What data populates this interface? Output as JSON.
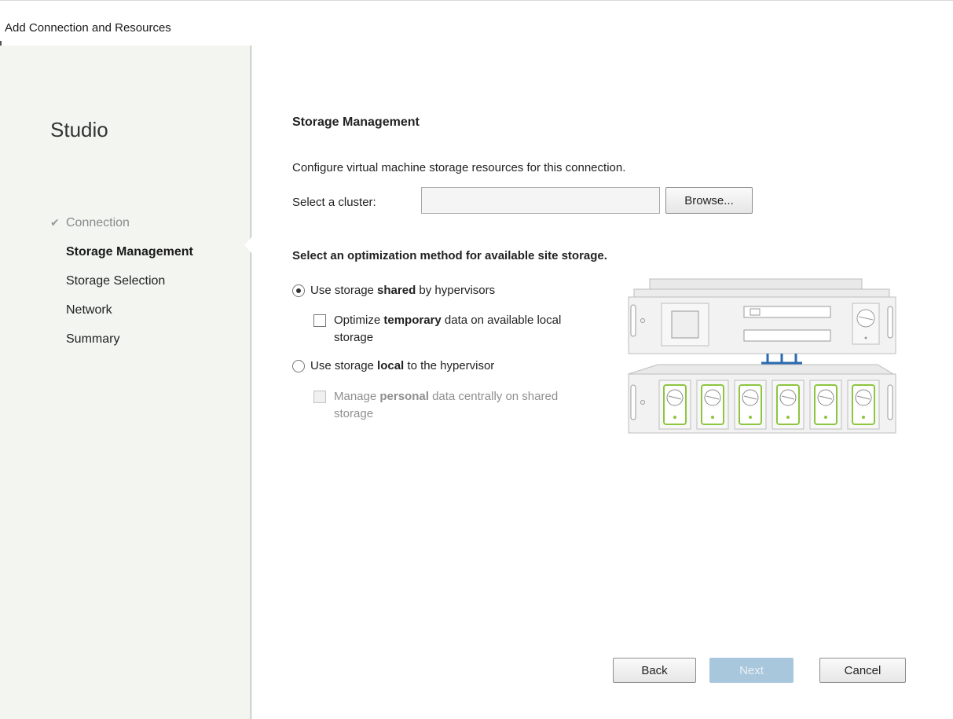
{
  "window": {
    "title": "Add Connection and Resources"
  },
  "sidebar": {
    "brand": "Studio",
    "steps": [
      {
        "label": "Connection",
        "state": "done",
        "check_glyph": "✔"
      },
      {
        "label": "Storage Management",
        "state": "active"
      },
      {
        "label": "Storage Selection",
        "state": "pending"
      },
      {
        "label": "Network",
        "state": "pending"
      },
      {
        "label": "Summary",
        "state": "pending"
      }
    ]
  },
  "main": {
    "heading": "Storage Management",
    "description": "Configure virtual machine storage resources for this connection.",
    "cluster": {
      "label": "Select a cluster:",
      "value": "",
      "browse_label": "Browse..."
    },
    "optimization_heading": "Select an optimization method for available site storage.",
    "options": {
      "shared": {
        "prefix": "Use storage ",
        "bold": "shared",
        "suffix": " by hypervisors",
        "selected": true
      },
      "temporary": {
        "prefix": "Optimize ",
        "bold": "temporary",
        "suffix": " data on available local storage",
        "checked": false,
        "enabled": true
      },
      "local": {
        "prefix": "Use storage ",
        "bold": "local",
        "suffix": " to the hypervisor",
        "selected": false
      },
      "personal": {
        "prefix": "Manage ",
        "bold": "personal",
        "suffix": " data centrally on shared storage",
        "checked": false,
        "enabled": false
      }
    },
    "illustration_icon": "shared-storage-servers-icon"
  },
  "footer": {
    "back_label": "Back",
    "next_label": "Next",
    "cancel_label": "Cancel",
    "next_enabled": false
  },
  "colors": {
    "sidebar_bg": "#f3f5f1",
    "disk_accent": "#8cc63f",
    "link_accent": "#2b6bb0",
    "next_disabled": "#a9c7dc"
  }
}
